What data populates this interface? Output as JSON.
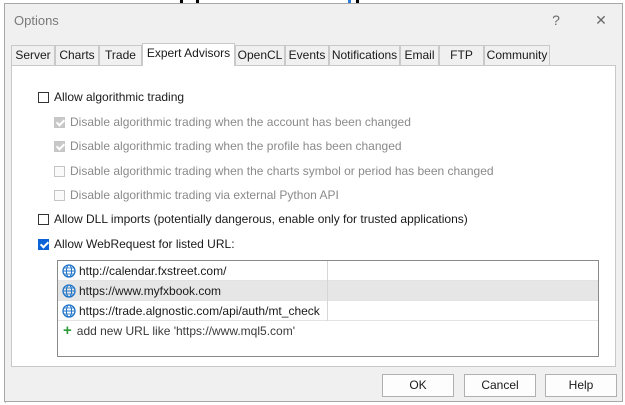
{
  "window": {
    "title": "Options",
    "help_glyph": "?",
    "close_glyph": "✕"
  },
  "tabs": [
    {
      "label": "Server"
    },
    {
      "label": "Charts"
    },
    {
      "label": "Trade"
    },
    {
      "label": "Expert Advisors"
    },
    {
      "label": "OpenCL"
    },
    {
      "label": "Events"
    },
    {
      "label": "Notifications"
    },
    {
      "label": "Email"
    },
    {
      "label": "FTP"
    },
    {
      "label": "Community"
    }
  ],
  "active_tab": "Expert Advisors",
  "options": {
    "allow_algo": {
      "label": "Allow algorithmic trading",
      "checked": false
    },
    "disable_account": {
      "label": "Disable algorithmic trading when the account has been changed",
      "checked": true,
      "enabled": false
    },
    "disable_profile": {
      "label": "Disable algorithmic trading when the profile has been changed",
      "checked": true,
      "enabled": false
    },
    "disable_symbol": {
      "label": "Disable algorithmic trading when the charts symbol or period has been changed",
      "checked": false,
      "enabled": false
    },
    "disable_python": {
      "label": "Disable algorithmic trading via external Python API",
      "checked": false,
      "enabled": false
    },
    "allow_dll": {
      "label": "Allow DLL imports (potentially dangerous, enable only for trusted applications)",
      "checked": false
    },
    "allow_webrequest": {
      "label": "Allow WebRequest for listed URL:",
      "checked": true
    }
  },
  "url_list": {
    "items": [
      {
        "url": "http://calendar.fxstreet.com/"
      },
      {
        "url": "https://www.myfxbook.com"
      },
      {
        "url": "https://trade.algnostic.com/api/auth/mt_check"
      }
    ],
    "selected_index": 1,
    "add_prompt": "add new URL like 'https://www.mql5.com'"
  },
  "buttons": {
    "ok": "OK",
    "cancel": "Cancel",
    "help": "Help"
  },
  "colors": {
    "accent": "#0a64d8",
    "globe": "#1e73c8",
    "add": "#2e9b3a"
  }
}
